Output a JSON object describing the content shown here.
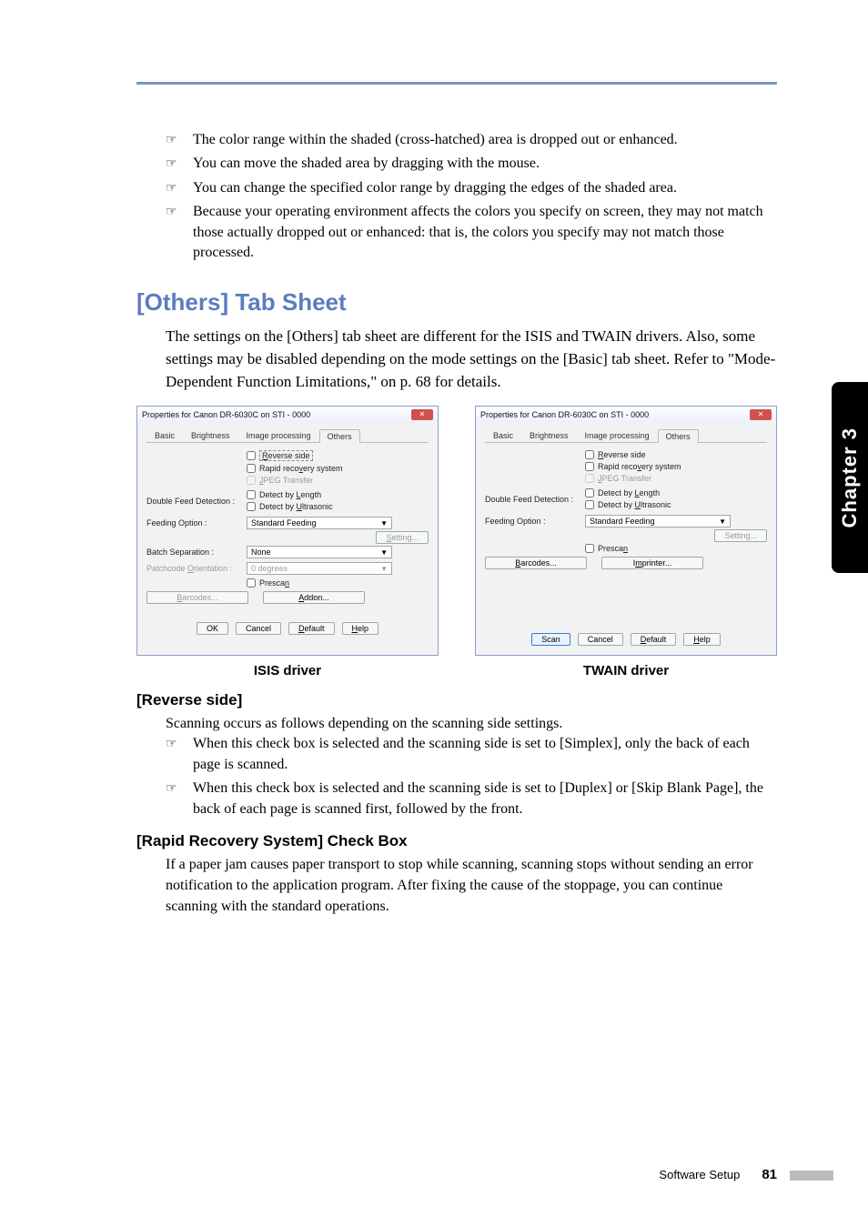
{
  "sideTab": "Chapter 3",
  "footer": {
    "section": "Software Setup",
    "page": "81"
  },
  "top_bullets": [
    "The color range within the shaded (cross-hatched) area is dropped out or enhanced.",
    "You can move the shaded area by dragging with the mouse.",
    "You can change the specified color range by dragging the edges of the shaded area.",
    "Because your operating environment affects the colors you specify on screen, they may not match those actually dropped out or enhanced: that is, the colors you specify may not match those processed."
  ],
  "heading_others": "[Others] Tab Sheet",
  "others_intro": "The settings on the [Others] tab sheet are different for the ISIS and TWAIN drivers. Also, some settings may be disabled depending on the mode settings on the [Basic] tab sheet. Refer to \"Mode-Dependent Function Limitations,\" on p. 68 for details.",
  "isis": {
    "title": "Properties for Canon DR-6030C on STI - 0000",
    "tabs": [
      "Basic",
      "Brightness",
      "Image processing",
      "Others"
    ],
    "reverse": "Reverse side",
    "rapid": "Rapid recovery system",
    "jpeg": "JPEG Transfer",
    "dfd_label": "Double Feed Detection :",
    "dfd1": "Detect by Length",
    "dfd2": "Detect by Ultrasonic",
    "feeding_label": "Feeding Option :",
    "feeding_value": "Standard Feeding",
    "setting_btn": "Setting...",
    "batch_label": "Batch Separation :",
    "batch_value": "None",
    "patch_label": "Patchcode Orientation :",
    "patch_value": "0 degrees",
    "prescan": "Prescan",
    "barcodes": "Barcodes...",
    "addon": "Addon...",
    "ok": "OK",
    "cancel": "Cancel",
    "default": "Default",
    "help": "Help"
  },
  "twain": {
    "title": "Properties for Canon DR-6030C on STI - 0000",
    "tabs": [
      "Basic",
      "Brightness",
      "Image processing",
      "Others"
    ],
    "reverse": "Reverse side",
    "rapid": "Rapid recovery system",
    "jpeg": "JPEG Transfer",
    "dfd_label": "Double Feed Detection :",
    "dfd1": "Detect by Length",
    "dfd2": "Detect by Ultrasonic",
    "feeding_label": "Feeding Option :",
    "feeding_value": "Standard Feeding",
    "setting_btn": "Setting...",
    "prescan": "Prescan",
    "barcodes": "Barcodes...",
    "imprinter": "Imprinter...",
    "scan": "Scan",
    "cancel": "Cancel",
    "default": "Default",
    "help": "Help"
  },
  "caption_isis": "ISIS driver",
  "caption_twain": "TWAIN driver",
  "sub_reverse_head": "[Reverse side]",
  "sub_reverse_intro": "Scanning occurs as follows depending on the scanning side settings.",
  "reverse_bullets": [
    "When this check box is selected and the scanning side is set to [Simplex], only the back of each page is scanned.",
    "When this check box is selected and the scanning side is set to [Duplex] or [Skip Blank Page],  the back of each page is scanned first, followed by the front."
  ],
  "sub_rapid_head": "[Rapid Recovery System] Check Box",
  "sub_rapid_body": "If a paper jam causes paper transport to stop while scanning, scanning stops without sending an error notification to the application program. After fixing the cause of the stoppage, you can continue scanning with the standard operations.",
  "pointer": "☞"
}
